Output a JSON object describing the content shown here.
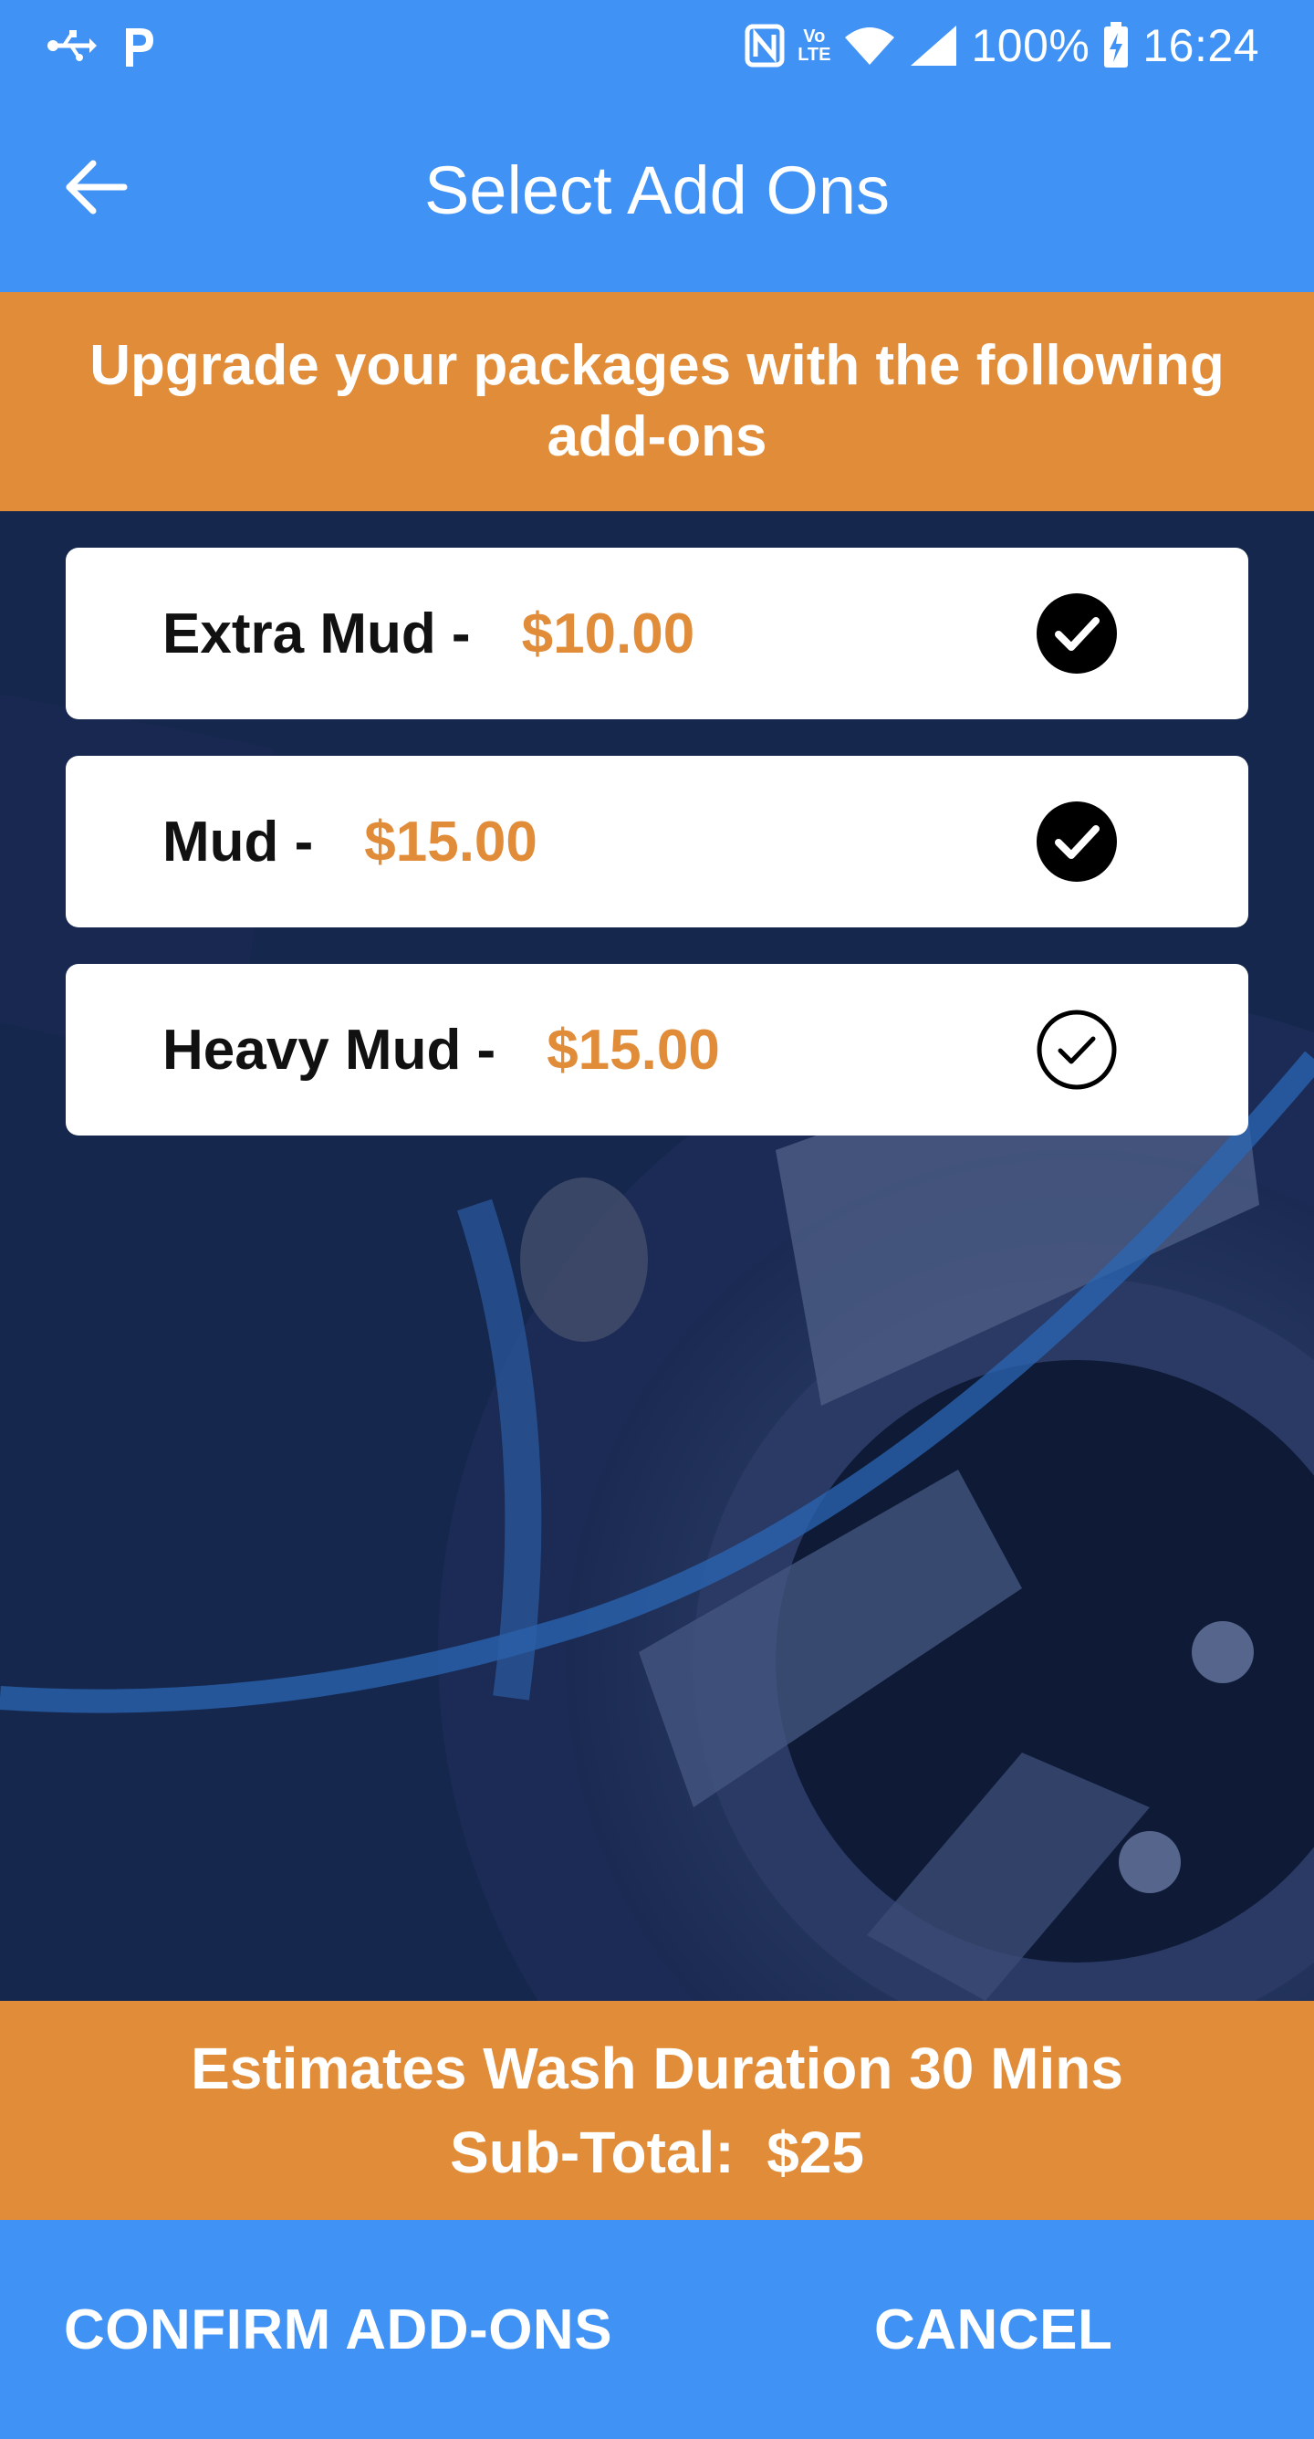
{
  "status_bar": {
    "battery": "100%",
    "time": "16:24",
    "volte_top": "Vo",
    "volte_bottom": "LTE",
    "icons": [
      "usb-icon",
      "parking-app-icon",
      "nfc-icon",
      "volte-icon",
      "wifi-icon",
      "cell-signal-icon",
      "battery-icon"
    ]
  },
  "app_bar": {
    "title": "Select Add Ons",
    "back_icon": "arrow-left-icon"
  },
  "banner": {
    "text": "Upgrade your packages with the following add-ons"
  },
  "addons": [
    {
      "name": "Extra Mud -",
      "price": "$10.00",
      "selected": true
    },
    {
      "name": "Mud -",
      "price": "$15.00",
      "selected": true
    },
    {
      "name": "Heavy Mud -",
      "price": "$15.00",
      "selected": false
    }
  ],
  "summary": {
    "duration": "Estimates Wash Duration 30 Mins",
    "subtotal": "Sub-Total:  $25"
  },
  "actions": {
    "confirm": "CONFIRM ADD-ONS",
    "cancel": "CANCEL"
  },
  "colors": {
    "primary": "#4192f5",
    "accent": "#e08c39",
    "card": "#ffffff",
    "text": "#111111"
  }
}
